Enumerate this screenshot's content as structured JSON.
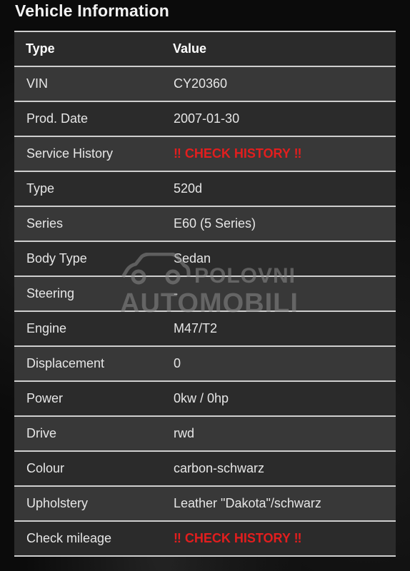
{
  "page": {
    "title": "Vehicle Information"
  },
  "table": {
    "headers": {
      "label": "Type",
      "value": "Value"
    },
    "rows": [
      {
        "label": "VIN",
        "value": "CY20360",
        "alert": false
      },
      {
        "label": "Prod. Date",
        "value": "2007-01-30",
        "alert": false
      },
      {
        "label": "Service History",
        "value": "‼ CHECK HISTORY ‼",
        "alert": true
      },
      {
        "label": "Type",
        "value": "520d",
        "alert": false
      },
      {
        "label": "Series",
        "value": "E60 (5 Series)",
        "alert": false
      },
      {
        "label": "Body Type",
        "value": "Sedan",
        "alert": false
      },
      {
        "label": "Steering",
        "value": "-",
        "alert": false
      },
      {
        "label": "Engine",
        "value": "M47/T2",
        "alert": false
      },
      {
        "label": "Displacement",
        "value": "0",
        "alert": false
      },
      {
        "label": "Power",
        "value": "0kw / 0hp",
        "alert": false
      },
      {
        "label": "Drive",
        "value": "rwd",
        "alert": false
      },
      {
        "label": "Colour",
        "value": "carbon-schwarz",
        "alert": false
      },
      {
        "label": "Upholstery",
        "value": "Leather \"Dakota\"/schwarz",
        "alert": false
      },
      {
        "label": "Check mileage",
        "value": "‼ CHECK HISTORY ‼",
        "alert": true
      }
    ]
  },
  "watermark": {
    "line1": "POLOVNI",
    "line2": "AUTOMOBILI",
    "icon": "car-icon"
  },
  "colors": {
    "alert": "#e21e1e",
    "row_light": "#383838",
    "row_dark": "#2b2b2b",
    "divider": "#cfcfcf"
  }
}
